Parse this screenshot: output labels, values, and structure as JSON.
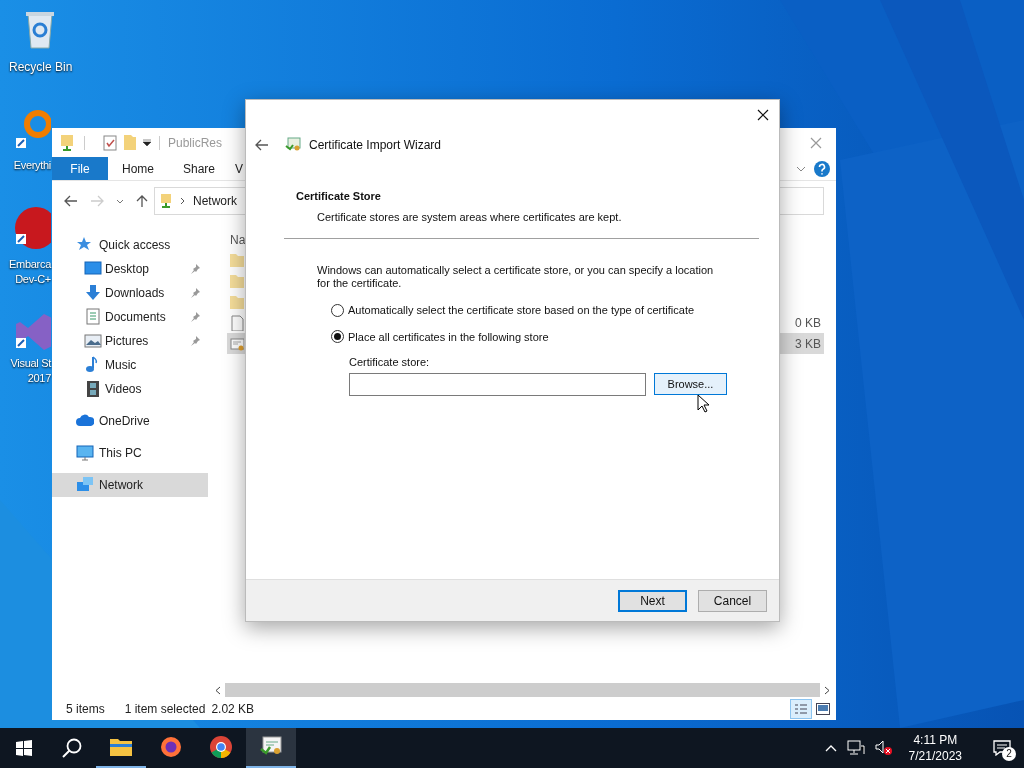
{
  "desktop": {
    "icons": [
      {
        "kind": "recycle-bin",
        "lines": [
          "Recycle Bin"
        ]
      },
      {
        "kind": "magnifier",
        "lines": [
          "Everythi"
        ]
      },
      {
        "kind": "dev",
        "lines": [
          "Embarca",
          "Dev-C+"
        ]
      },
      {
        "kind": "visual-studio",
        "lines": [
          "Visual St",
          "2017"
        ]
      }
    ]
  },
  "explorer": {
    "title": "PublicRes",
    "ribbon_tabs": [
      {
        "label": "File",
        "selected": true
      },
      {
        "label": "Home",
        "selected": false
      },
      {
        "label": "Share",
        "selected": false
      },
      {
        "label": "V",
        "selected": false
      }
    ],
    "address": {
      "path": "Network"
    },
    "nav": [
      {
        "kind": "quick",
        "label": "Quick access",
        "selected": false,
        "children": [
          {
            "kind": "desktop",
            "label": "Desktop",
            "pinned": true
          },
          {
            "kind": "downloads",
            "label": "Downloads",
            "pinned": true
          },
          {
            "kind": "documents",
            "label": "Documents",
            "pinned": true
          },
          {
            "kind": "pictures",
            "label": "Pictures",
            "pinned": true
          },
          {
            "kind": "music",
            "label": "Music",
            "pinned": false
          },
          {
            "kind": "videos",
            "label": "Videos",
            "pinned": false
          }
        ]
      },
      {
        "kind": "onedrive",
        "label": "OneDrive",
        "selected": false
      },
      {
        "kind": "pc",
        "label": "This PC",
        "selected": false
      },
      {
        "kind": "network",
        "label": "Network",
        "selected": true
      }
    ],
    "column_1": "Na",
    "files": [
      {
        "kind": "folder",
        "selected": false
      },
      {
        "kind": "folder",
        "selected": false
      },
      {
        "kind": "folder",
        "selected": false
      },
      {
        "kind": "file",
        "size": "0 KB",
        "selected": false
      },
      {
        "kind": "certificate",
        "size": "3 KB",
        "selected": true
      }
    ],
    "status_bar": {
      "items": "5 items",
      "selection": "1 item selected",
      "size": "2.02 KB"
    }
  },
  "dialog": {
    "title": "Certificate Import Wizard",
    "heading": "Certificate Store",
    "subheading": "Certificate stores are system areas where certificates are kept.",
    "instruction": "Windows can automatically select a certificate store, or you can specify a location for the certificate.",
    "options": [
      {
        "label": "Automatically select the certificate store based on the type of certificate",
        "selected": false
      },
      {
        "label": "Place all certificates in the following store",
        "selected": true
      }
    ],
    "store_label": "Certificate store:",
    "browse": {
      "label": "Browse...",
      "hovered": true
    },
    "buttons": [
      {
        "label": "Next",
        "default": true
      },
      {
        "label": "Cancel",
        "default": false
      }
    ]
  },
  "taskbar": {
    "apps": [
      {
        "kind": "explorer",
        "running": true,
        "active": false
      },
      {
        "kind": "firefox",
        "running": false,
        "active": false
      },
      {
        "kind": "chrome",
        "running": false,
        "active": false
      },
      {
        "kind": "certificate",
        "running": true,
        "active": true
      }
    ],
    "time": "4:11 PM",
    "date": "7/21/2023",
    "notifications": "2"
  }
}
